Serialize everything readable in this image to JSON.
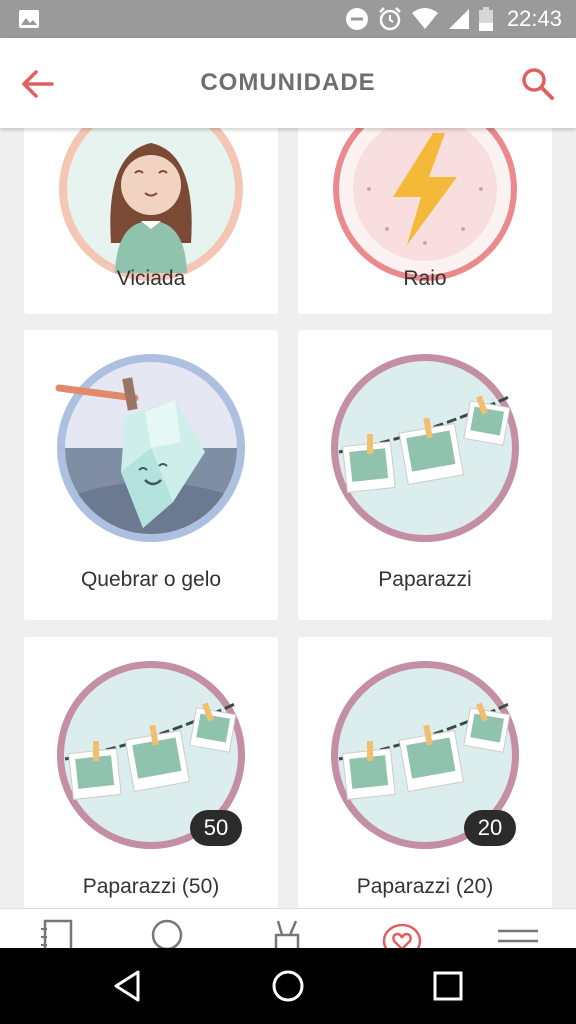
{
  "status_bar": {
    "time": "22:43",
    "icons": [
      "image-icon",
      "do-not-disturb-icon",
      "alarm-icon",
      "wifi-icon",
      "signal-icon",
      "battery-icon"
    ]
  },
  "header": {
    "title": "COMUNIDADE",
    "icons": [
      "back-arrow-icon",
      "search-icon"
    ],
    "accent_color": "#e0605f"
  },
  "badges": [
    {
      "label": "Viciada",
      "art": "girl-avatar"
    },
    {
      "label": "Raio",
      "art": "lightning"
    },
    {
      "label": "Quebrar o gelo",
      "art": "ice-break"
    },
    {
      "label": "Paparazzi",
      "art": "photos-clothesline"
    },
    {
      "label": "Paparazzi (50)",
      "art": "photos-clothesline",
      "count": "50"
    },
    {
      "label": "Paparazzi (20)",
      "art": "photos-clothesline",
      "count": "20"
    }
  ],
  "tab_bar": {
    "icons": [
      "notebook-icon",
      "search-icon",
      "tools-icon",
      "heart-icon",
      "menu-icon"
    ],
    "active": "heart-icon"
  },
  "nav_bar": {
    "icons": [
      "back-triangle-icon",
      "home-circle-icon",
      "recents-square-icon"
    ]
  }
}
